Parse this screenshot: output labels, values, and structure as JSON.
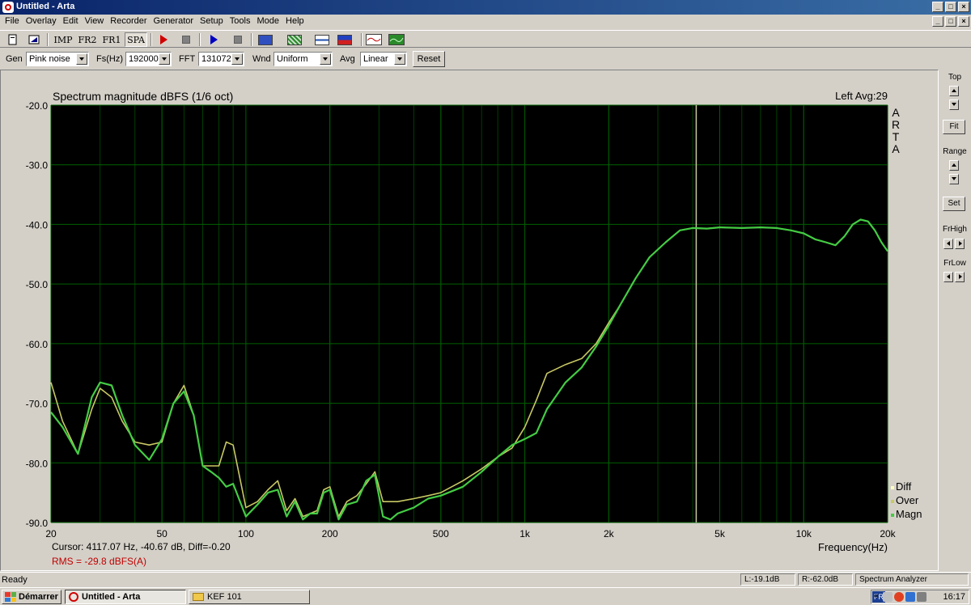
{
  "window": {
    "title": "Untitled - Arta",
    "minimize": "_",
    "maximize": "□",
    "close": "×"
  },
  "menu": [
    "File",
    "Overlay",
    "Edit",
    "View",
    "Recorder",
    "Generator",
    "Setup",
    "Tools",
    "Mode",
    "Help"
  ],
  "toolbar": {
    "imp": "IMP",
    "fr2": "FR2",
    "fr1": "FR1",
    "spa": "SPA"
  },
  "params": {
    "gen_label": "Gen",
    "gen_value": "Pink noise",
    "fs_label": "Fs(Hz)",
    "fs_value": "192000",
    "fft_label": "FFT",
    "fft_value": "131072",
    "wnd_label": "Wnd",
    "wnd_value": "Uniform",
    "avg_label": "Avg",
    "avg_value": "Linear",
    "reset_label": "Reset"
  },
  "plot": {
    "title": "Spectrum magnitude dBFS (1/6 oct)",
    "info": "Left  Avg:29",
    "watermark": [
      "A",
      "R",
      "T",
      "A"
    ],
    "xlabel": "Frequency(Hz)",
    "cursor": "Cursor:  4117.07 Hz, -40.67 dB,  Diff=-0.20",
    "rms": "RMS =  -29.8 dBFS(A)",
    "colors": {
      "background": "#000000",
      "grid": "#006000",
      "minor_grid": "#004000",
      "magn": "#44cc44",
      "over": "#c8c864",
      "diff": "#ffffc0",
      "cursor": "#c8c8a0",
      "rms": "#c00000"
    }
  },
  "right_panel": {
    "top": "Top",
    "fit": "Fit",
    "range": "Range",
    "set": "Set",
    "frhigh": "FrHigh",
    "frlow": "FrLow"
  },
  "status": {
    "left": "Ready",
    "l": "L:-19.1dB",
    "r": "R:-62.0dB",
    "mode": "Spectrum Analyzer"
  },
  "taskbar": {
    "start": "Démarrer",
    "task1": "Untitled - Arta",
    "task2": "KEF 101",
    "lang": "FR",
    "clock": "16:17"
  },
  "chart_data": {
    "type": "line",
    "xscale": "log",
    "xlim": [
      20,
      20000
    ],
    "ylim": [
      -90,
      -20
    ],
    "xticks": [
      20,
      50,
      100,
      200,
      500,
      1000,
      2000,
      5000,
      10000,
      20000
    ],
    "xtick_labels": [
      "20",
      "50",
      "100",
      "200",
      "500",
      "1k",
      "2k",
      "5k",
      "10k",
      "20k"
    ],
    "yticks": [
      -20,
      -30,
      -40,
      -50,
      -60,
      -70,
      -80,
      -90
    ],
    "ytick_labels": [
      "-20.0",
      "-30.0",
      "-40.0",
      "-50.0",
      "-60.0",
      "-70.0",
      "-80.0",
      "-90.0"
    ],
    "cursor_x": 4117.07,
    "legend": [
      "Diff",
      "Over",
      "Magn"
    ],
    "legend_position": "bottom-right",
    "series": [
      {
        "name": "Over",
        "x": [
          20,
          22,
          25,
          28,
          30,
          33,
          36,
          40,
          45,
          50,
          55,
          60,
          65,
          70,
          75,
          80,
          85,
          90,
          100,
          110,
          120,
          130,
          140,
          150,
          160,
          170,
          180,
          190,
          200,
          215,
          230,
          250,
          270,
          290,
          310,
          330,
          350,
          400,
          450,
          500,
          600,
          700,
          800,
          900,
          1000,
          1100,
          1200,
          1400,
          1600,
          1800,
          2000,
          2200,
          2500,
          2800,
          3200,
          3600,
          4000,
          4500,
          5000,
          6000,
          7000,
          8000,
          9000,
          10000,
          11000,
          12000,
          13000,
          14000,
          15000,
          16000,
          17000,
          18000,
          19000,
          20000
        ],
        "y": [
          -66.5,
          -73,
          -78.5,
          -71,
          -67.5,
          -69,
          -73,
          -76.5,
          -77,
          -76.5,
          -70,
          -67,
          -72,
          -80.5,
          -80.5,
          -80.5,
          -76.5,
          -77,
          -87.5,
          -86.5,
          -84.5,
          -83,
          -88,
          -86,
          -89,
          -88.5,
          -88,
          -84.5,
          -84,
          -89,
          -86.5,
          -85.5,
          -83.5,
          -81.5,
          -86.5,
          -86.5,
          -86.5,
          -86,
          -85.5,
          -85,
          -83,
          -81,
          -79,
          -77.5,
          -74,
          -69.5,
          -65,
          -63.5,
          -62.5,
          -60,
          -56.5,
          -53.5,
          -49,
          -45.5,
          -43,
          -41,
          -40.6,
          -40.7,
          -40.5,
          -40.6,
          -40.5,
          -40.6,
          -41,
          -41.5,
          -42.5,
          -43,
          -43.5,
          -42,
          -40,
          -39.2,
          -39.5,
          -41,
          -43,
          -44.5
        ]
      },
      {
        "name": "Magn",
        "x": [
          20,
          22,
          25,
          28,
          30,
          33,
          36,
          40,
          45,
          50,
          55,
          60,
          65,
          70,
          75,
          80,
          85,
          90,
          100,
          110,
          120,
          130,
          140,
          150,
          160,
          170,
          180,
          190,
          200,
          215,
          230,
          250,
          270,
          290,
          310,
          330,
          350,
          400,
          450,
          500,
          600,
          700,
          800,
          900,
          1000,
          1100,
          1200,
          1400,
          1600,
          1800,
          2000,
          2200,
          2500,
          2800,
          3200,
          3600,
          4000,
          4500,
          5000,
          6000,
          7000,
          8000,
          9000,
          10000,
          11000,
          12000,
          13000,
          14000,
          15000,
          16000,
          17000,
          18000,
          19000,
          20000
        ],
        "y": [
          -71.5,
          -74,
          -78.5,
          -69,
          -66.5,
          -67,
          -72,
          -77,
          -79.5,
          -76,
          -70,
          -68,
          -72,
          -80.5,
          -81.5,
          -82.5,
          -84,
          -83.5,
          -89,
          -87,
          -85,
          -84.5,
          -89,
          -86.5,
          -89.5,
          -88.5,
          -88.5,
          -85,
          -84.5,
          -89.5,
          -87,
          -86.5,
          -83,
          -82,
          -89,
          -89.5,
          -88.5,
          -87.5,
          -86,
          -85.5,
          -84,
          -81.5,
          -79,
          -77,
          -76,
          -75,
          -71,
          -66.5,
          -64,
          -60.5,
          -57,
          -53.5,
          -49,
          -45.5,
          -43,
          -41,
          -40.6,
          -40.7,
          -40.5,
          -40.6,
          -40.5,
          -40.6,
          -41,
          -41.5,
          -42.5,
          -43,
          -43.5,
          -42,
          -40,
          -39.2,
          -39.5,
          -41,
          -43,
          -44.5
        ]
      }
    ]
  }
}
